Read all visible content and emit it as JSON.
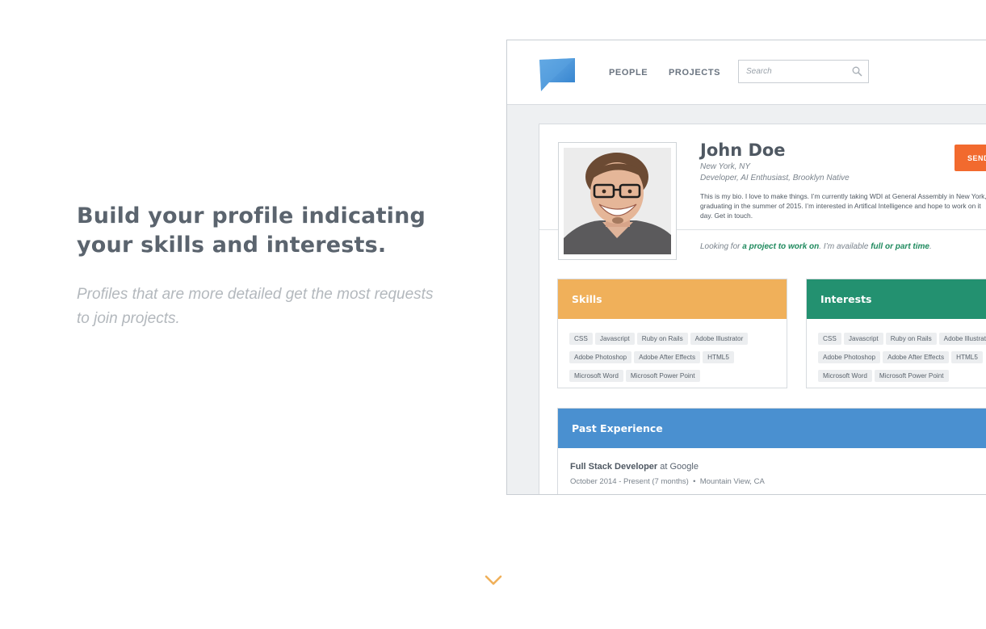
{
  "hero": {
    "title": "Build your profile indicating your skills and interests.",
    "subtitle": "Profiles that are more detailed get the most requests to join projects."
  },
  "mockup": {
    "nav": {
      "people": "PEOPLE",
      "projects": "PROJECTS"
    },
    "search": {
      "placeholder": "Search"
    },
    "profile": {
      "name": "John Doe",
      "location": "New York, NY",
      "tagline": "Developer, AI Enthusiast, Brooklyn Native",
      "bio_lines": [
        "This is my bio. I love to make things. I’m currently taking WDI at General Assembly in New York,",
        "graduating in the summer of 2015. I’m interested in Artifical Intelligence and hope to work on it",
        "day. Get in touch."
      ],
      "send_button": "SEND",
      "looking": {
        "prefix": "Looking for ",
        "highlight1": "a project to work on",
        "middle": ". I’m available ",
        "highlight2": "full or part time",
        "suffix": "."
      }
    },
    "skills": {
      "title": "Skills",
      "tags": [
        "CSS",
        "Javascript",
        "Ruby on Rails",
        "Adobe Illustrator",
        "Adobe Photoshop",
        "Adobe After Effects",
        "HTML5",
        "Microsoft Word",
        "Microsoft Power Point"
      ]
    },
    "interests": {
      "title": "Interests",
      "tags": [
        "CSS",
        "Javascript",
        "Ruby on Rails",
        "Adobe Illustrator",
        "Adobe Photoshop",
        "Adobe After Effects",
        "HTML5",
        "Microsoft Word",
        "Microsoft Power Point"
      ]
    },
    "experience": {
      "title": "Past Experience",
      "job_role": "Full Stack Developer",
      "job_at": " at Google",
      "job_dates": "October 2014 - Present (7 months)",
      "job_location": "Mountain View, CA"
    }
  },
  "colors": {
    "send": "#f26a2e",
    "skills": "#f0b05a",
    "interests": "#239170",
    "experience": "#4a90d0",
    "chevron": "#f0b05a"
  },
  "icons": [
    "logo-icon",
    "search-icon",
    "chevron-down-icon"
  ]
}
